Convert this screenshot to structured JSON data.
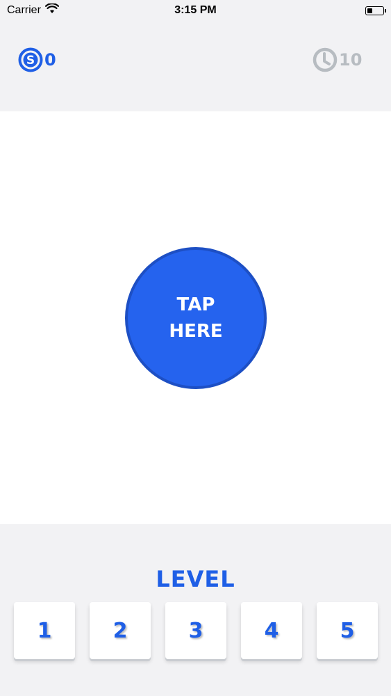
{
  "status_bar": {
    "carrier": "Carrier",
    "time": "3:15 PM",
    "icons": [
      "wifi-icon",
      "battery-icon"
    ]
  },
  "hud": {
    "coins": {
      "icon": "dollar-coin-icon",
      "value": "0"
    },
    "timer": {
      "icon": "clock-icon",
      "value": "10"
    }
  },
  "tap_button": {
    "line1": "TAP",
    "line2": "HERE"
  },
  "level_panel": {
    "title": "LEVEL",
    "levels": [
      "1",
      "2",
      "3",
      "4",
      "5"
    ]
  },
  "colors": {
    "accent_blue": "#1f5fe6",
    "button_blue": "#2563ee",
    "muted_gray": "#b7bcc1",
    "panel_bg": "#f2f2f4"
  }
}
